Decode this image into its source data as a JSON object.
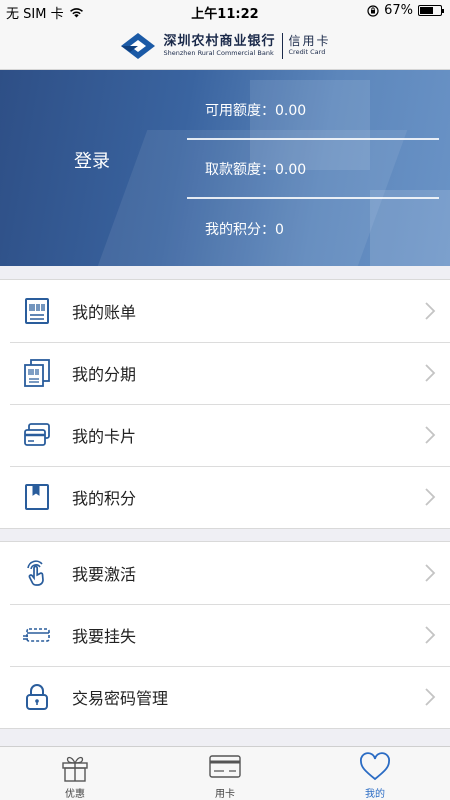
{
  "status_bar": {
    "carrier": "无 SIM 卡",
    "time": "上午11:22",
    "battery": "67%",
    "battery_level": 0.67
  },
  "header": {
    "brand_cn": "深圳农村商业银行",
    "brand_en": "Shenzhen Rural Commercial Bank",
    "card_cn": "信用卡",
    "card_en": "Credit Card",
    "brand_color": "#1b5aa6"
  },
  "account": {
    "login_label": "登录",
    "available_credit": "可用额度：0.00",
    "cash_limit": "取款额度：0.00",
    "points": "我的积分：0"
  },
  "menu_group_1": [
    {
      "label": "我的账单",
      "icon": "bill-icon"
    },
    {
      "label": "我的分期",
      "icon": "installment-icon"
    },
    {
      "label": "我的卡片",
      "icon": "card-icon"
    },
    {
      "label": "我的积分",
      "icon": "points-icon"
    }
  ],
  "menu_group_2": [
    {
      "label": "我要激活",
      "icon": "activate-icon"
    },
    {
      "label": "我要挂失",
      "icon": "report-loss-icon"
    },
    {
      "label": "交易密码管理",
      "icon": "lock-icon"
    }
  ],
  "tabs": [
    {
      "label": "优惠",
      "icon": "gift-icon",
      "active": false
    },
    {
      "label": "用卡",
      "icon": "card-icon",
      "active": false
    },
    {
      "label": "我的",
      "icon": "heart-icon",
      "active": true
    }
  ],
  "colors": {
    "accent": "#2b6cc4",
    "icon": "#2a5d9c",
    "banner": "#3a64a0"
  }
}
